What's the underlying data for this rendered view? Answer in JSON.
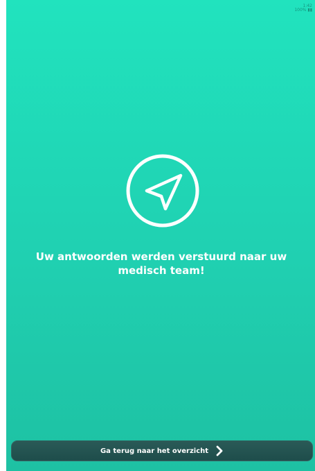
{
  "status": {
    "line1": "1:42",
    "line2": "100% ▮▮"
  },
  "icon": {
    "name": "paper-plane-icon"
  },
  "main": {
    "message": "Uw antwoorden werden verstuurd naar uw\nmedisch team!"
  },
  "footer": {
    "back_label": "Ga terug naar het overzicht"
  },
  "colors": {
    "accent": "#21E3BE",
    "button_bg": "#1E4D4B",
    "text": "#FFFFFF"
  }
}
